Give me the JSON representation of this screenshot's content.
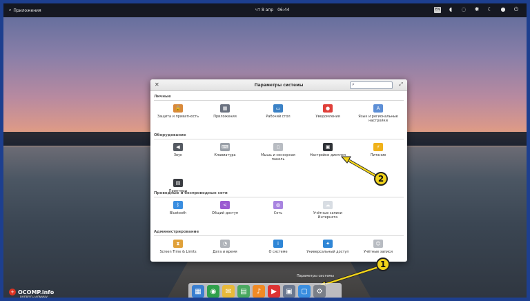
{
  "topbar": {
    "apps_label": "Приложения",
    "clock_day": "чт 8 апр",
    "clock_time": "06:44",
    "tray_box": "EN"
  },
  "window": {
    "title": "Параметры системы",
    "search_placeholder": ""
  },
  "sections": [
    {
      "title": "Личные",
      "items": [
        {
          "label": "Защита и приватность",
          "icon": "lock-icon",
          "color": "#d98a3a"
        },
        {
          "label": "Приложения",
          "icon": "apps-icon",
          "color": "#6b7280"
        },
        {
          "label": "Рабочий стол",
          "icon": "desktop-icon",
          "color": "#3b82c6"
        },
        {
          "label": "Уведомления",
          "icon": "notification-icon",
          "color": "#e0403a"
        },
        {
          "label": "Язык и региональные настройки",
          "icon": "language-icon",
          "color": "#5d8fd6"
        }
      ]
    },
    {
      "title": "Оборудование",
      "items": [
        {
          "label": "Звук",
          "icon": "sound-icon",
          "color": "#555a62"
        },
        {
          "label": "Клавиатура",
          "icon": "keyboard-icon",
          "color": "#9aa0a8"
        },
        {
          "label": "Мышь и сенсорная панель",
          "icon": "mouse-icon",
          "color": "#b8bcc2"
        },
        {
          "label": "Настройки дисплея",
          "icon": "display-icon",
          "color": "#2f3237"
        },
        {
          "label": "Питание",
          "icon": "power-icon",
          "color": "#f0b21a"
        },
        {
          "label": "Принтеры",
          "icon": "printer-icon",
          "color": "#3a3d42"
        }
      ]
    },
    {
      "title": "Проводные и беспроводные сети",
      "items": [
        {
          "label": "Bluetooth",
          "icon": "bluetooth-icon",
          "color": "#3a8ee0"
        },
        {
          "label": "Общий доступ",
          "icon": "share-icon",
          "color": "#9b5bd1"
        },
        {
          "label": "Сеть",
          "icon": "network-icon",
          "color": "#a884e0"
        },
        {
          "label": "Учётные записи Интернета",
          "icon": "cloud-icon",
          "color": "#d8dde3"
        }
      ]
    },
    {
      "title": "Администрирование",
      "items": [
        {
          "label": "Screen Time & Limits",
          "icon": "screen-time-icon",
          "color": "#e0a13a"
        },
        {
          "label": "Дата и время",
          "icon": "clock-icon",
          "color": "#b0b4ba"
        },
        {
          "label": "О системе",
          "icon": "info-icon",
          "color": "#2f86d6"
        },
        {
          "label": "Универсальный доступ",
          "icon": "accessibility-icon",
          "color": "#2f86d6"
        },
        {
          "label": "Учётные записи",
          "icon": "users-icon",
          "color": "#b8bcc2"
        }
      ]
    }
  ],
  "badges": {
    "one": "1",
    "two": "2"
  },
  "dock": {
    "tooltip": "Параметры системы",
    "apps": [
      {
        "icon": "multitasking-icon",
        "color": "#3a7fd0"
      },
      {
        "icon": "browser-icon",
        "color": "#2fa04a"
      },
      {
        "icon": "mail-icon",
        "color": "#e8b93a"
      },
      {
        "icon": "calendar-icon",
        "color": "#4aa860"
      },
      {
        "icon": "music-icon",
        "color": "#f08a24"
      },
      {
        "icon": "video-icon",
        "color": "#d33"
      },
      {
        "icon": "photos-icon",
        "color": "#6a7890"
      },
      {
        "icon": "appcenter-icon",
        "color": "#3a8ee0"
      },
      {
        "icon": "settings-icon",
        "color": "#7a7f88"
      }
    ]
  },
  "watermark": {
    "title": "OCOMP.info",
    "subtitle": "ВОПРОСЫ АДМИНУ"
  }
}
